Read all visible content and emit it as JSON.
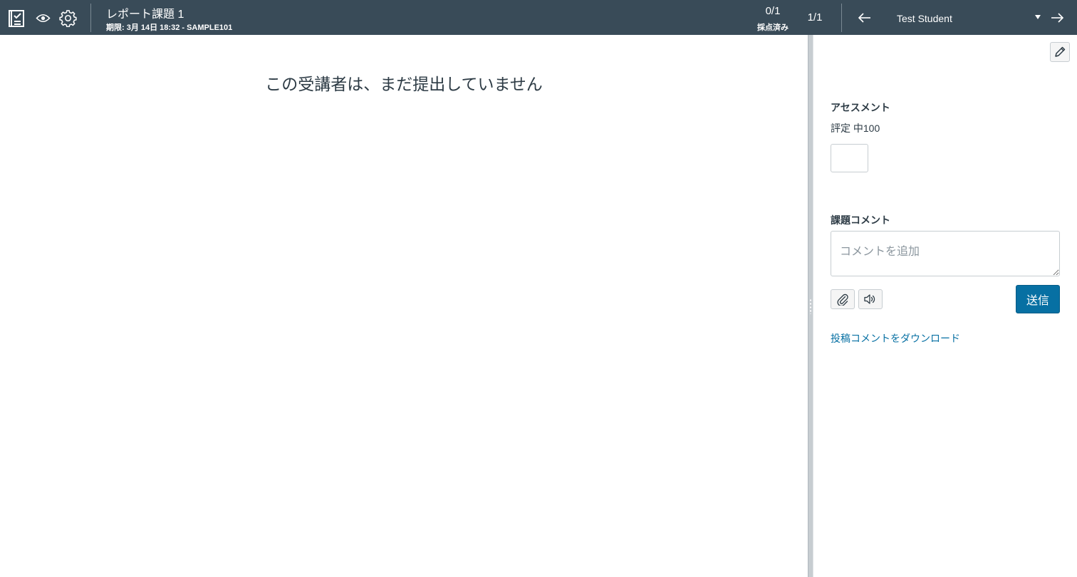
{
  "header": {
    "assignment_title": "レポート課題 1",
    "assignment_details": "期限: 3月 14日 18:32 - SAMPLE101",
    "graded_count": "0/1",
    "graded_label": "採点済み",
    "student_position": "1/1",
    "student_name": "Test Student",
    "icons": [
      "gradebook-icon",
      "eye-icon",
      "gear-icon",
      "arrow-left-icon",
      "arrow-right-icon",
      "caret-down-icon"
    ]
  },
  "main": {
    "message": "この受講者は、まだ提出していません"
  },
  "sidebar": {
    "assessment_heading": "アセスメント",
    "grade_label": "評定 中100",
    "grade_value": "",
    "comments_heading": "課題コメント",
    "comment_placeholder": "コメントを追加",
    "submit_label": "送信",
    "download_link": "投稿コメントをダウンロード",
    "icons": [
      "pencil-icon",
      "paperclip-icon",
      "media-icon"
    ]
  },
  "colors": {
    "header_bg": "#394b58",
    "text": "#2d3b45",
    "primary": "#0770a3",
    "border": "#c7cdd1"
  }
}
